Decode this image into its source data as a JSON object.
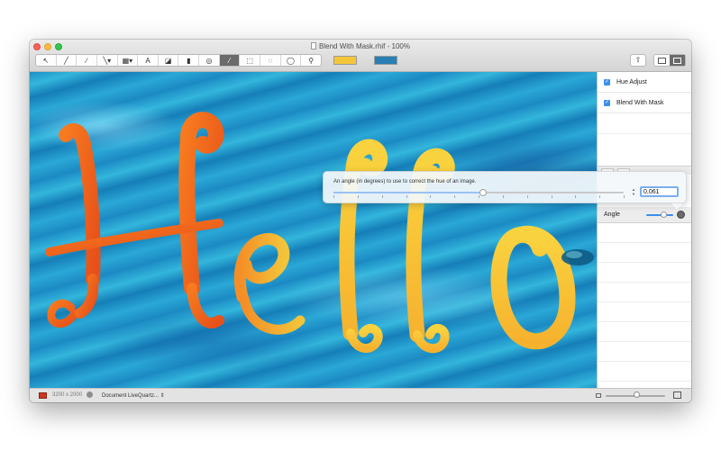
{
  "window": {
    "title": "Blend With Mask.rhif - 100%"
  },
  "toolbar": {
    "tools": [
      {
        "name": "arrow-select",
        "glyph": "↖"
      },
      {
        "name": "brush",
        "glyph": "╱"
      },
      {
        "name": "smudge",
        "glyph": "∕"
      },
      {
        "name": "line",
        "glyph": "╲▾"
      },
      {
        "name": "gradient",
        "glyph": "▦▾"
      },
      {
        "name": "text",
        "glyph": "A"
      },
      {
        "name": "eraser",
        "glyph": "◪"
      },
      {
        "name": "bookmark",
        "glyph": "▮"
      },
      {
        "name": "fx",
        "glyph": "◎"
      },
      {
        "name": "eyedropper",
        "glyph": "⁄"
      },
      {
        "name": "rect-select",
        "glyph": "⬚"
      },
      {
        "name": "ellipse-select",
        "glyph": "◌"
      },
      {
        "name": "lasso",
        "glyph": "◯"
      },
      {
        "name": "zoom",
        "glyph": "⚲"
      }
    ],
    "active_tool": "eyedropper",
    "fill_color": "#f3c63a",
    "stroke_color": "#2a7fb3"
  },
  "canvas": {
    "text": "Hello"
  },
  "statusbar": {
    "image_size": "3200 x 2000",
    "document_menu": "Document LiveQuartz..."
  },
  "sidebar": {
    "filters": [
      {
        "label": "Hue Adjust",
        "checked": true
      },
      {
        "label": "Blend With Mask",
        "checked": true
      }
    ],
    "parameter": {
      "label": "Angle"
    }
  },
  "popover": {
    "description": "An angle (in degrees) to use to correct the hue of an image.",
    "value": "0,061",
    "slider_fraction": 0.51
  }
}
